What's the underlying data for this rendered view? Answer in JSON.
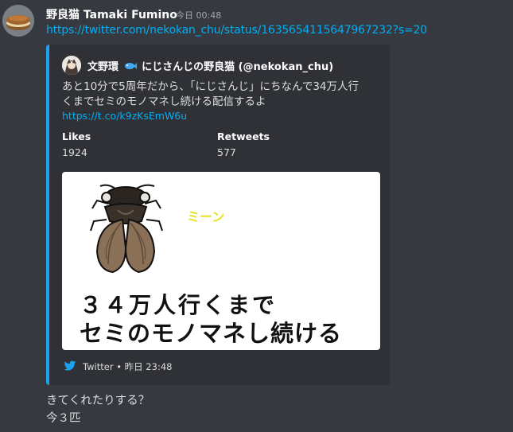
{
  "message": {
    "username": "野良猫 Tamaki Fumino",
    "timestamp": "今日 00:48",
    "link": "https://twitter.com/nekokan_chu/status/1635654115647967232?s=20",
    "avatar_icon": "dorayaki-avatar-icon"
  },
  "embed": {
    "accent_color": "#1da1f2",
    "author_prefix": "文野環",
    "author_suffix": "にじさんじの野良猫 (@nekokan_chu)",
    "author_badge_icon": "fish-icon",
    "description_line1": "あと10分で5周年だから、「にじさんじ」にちなんで34万人行",
    "description_line2": "くまでセミのモノマネし続ける配信するよ",
    "url": "https://t.co/k9zKsEmW6u",
    "fields": [
      {
        "name": "Likes",
        "value": "1924"
      },
      {
        "name": "Retweets",
        "value": "577"
      }
    ],
    "image": {
      "sound_text": "ミーン",
      "line1": "３４万人行くまで",
      "line2": "セミのモノマネし続ける"
    },
    "footer": {
      "source": "Twitter",
      "time": "昨日 23:48",
      "separator": "•",
      "icon": "twitter-bird-icon"
    }
  },
  "followups": [
    {
      "text": "きてくれたりする？"
    },
    {
      "text": "今３匹"
    }
  ]
}
